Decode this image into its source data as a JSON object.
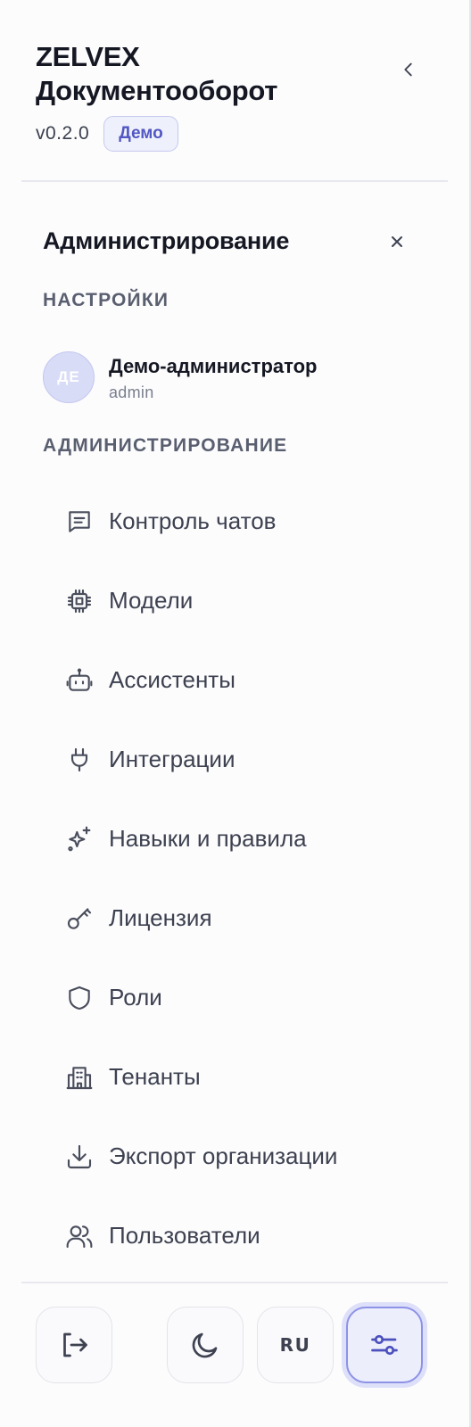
{
  "brand": {
    "name": "ZELVEX Документооборот",
    "version": "v0.2.0",
    "badge": "Демо"
  },
  "panel": {
    "title": "Администрирование"
  },
  "settings_group": {
    "label": "НАСТРОЙКИ",
    "user": {
      "initials": "ДЕ",
      "name": "Демо-администратор",
      "login": "admin"
    }
  },
  "admin_group": {
    "label": "АДМИНИСТРИРОВАНИЕ",
    "items": [
      {
        "label": "Контроль чатов",
        "icon": "chat-list-icon"
      },
      {
        "label": "Модели",
        "icon": "cpu-chip-icon"
      },
      {
        "label": "Ассистенты",
        "icon": "robot-icon"
      },
      {
        "label": "Интеграции",
        "icon": "plug-icon"
      },
      {
        "label": "Навыки и правила",
        "icon": "sparkles-icon"
      },
      {
        "label": "Лицензия",
        "icon": "key-icon"
      },
      {
        "label": "Роли",
        "icon": "shield-icon"
      },
      {
        "label": "Тенанты",
        "icon": "building-icon"
      },
      {
        "label": "Экспорт организации",
        "icon": "download-icon"
      },
      {
        "label": "Пользователи",
        "icon": "users-icon"
      }
    ]
  },
  "footer": {
    "logout_icon": "logout-icon",
    "theme_icon": "moon-icon",
    "language": "RU",
    "settings_icon": "sliders-icon"
  },
  "colors": {
    "accent": "#5257c3",
    "accent_soft": "#eef0fb",
    "text": "#151823",
    "muted": "#5a5f70"
  }
}
